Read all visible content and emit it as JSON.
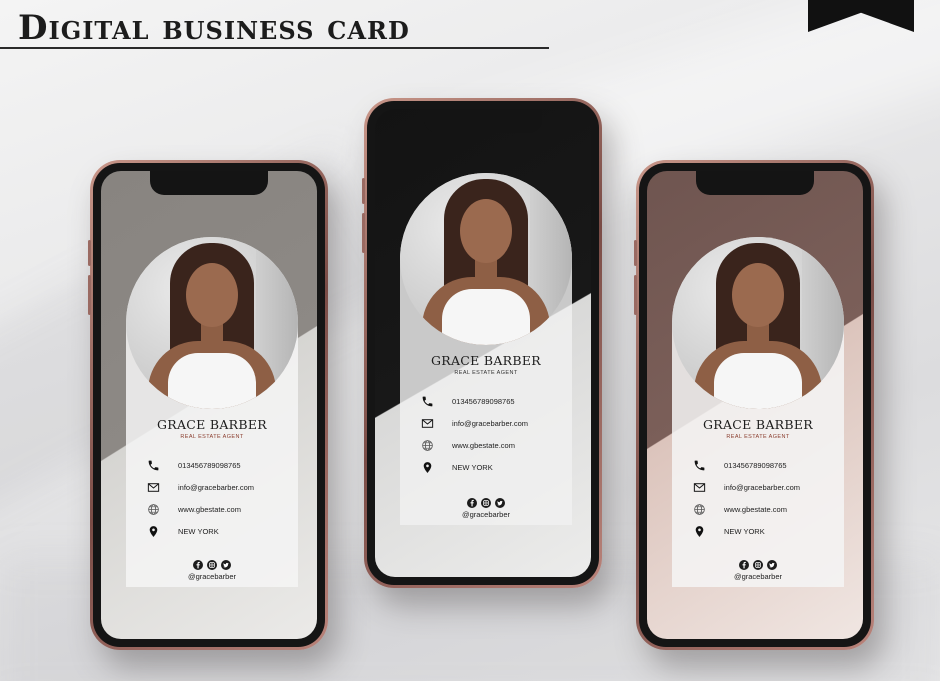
{
  "header": {
    "title": "Digital business card"
  },
  "cards": [
    {
      "name": "GRACE BARBER",
      "role": "REAL ESTATE AGENT",
      "contacts": [
        {
          "icon": "phone-icon",
          "text": "013456789098765"
        },
        {
          "icon": "email-icon",
          "text": "info@gracebarber.com"
        },
        {
          "icon": "globe-icon",
          "text": "www.gbestate.com"
        },
        {
          "icon": "location-pin-icon",
          "text": "NEW YORK"
        }
      ],
      "social_handle": "@gracebarber"
    },
    {
      "name": "GRACE BARBER",
      "role": "REAL ESTATE AGENT",
      "contacts": [
        {
          "icon": "phone-icon",
          "text": "013456789098765"
        },
        {
          "icon": "email-icon",
          "text": "info@gracebarber.com"
        },
        {
          "icon": "globe-icon",
          "text": "www.gbestate.com"
        },
        {
          "icon": "location-pin-icon",
          "text": "NEW YORK"
        }
      ],
      "social_handle": "@gracebarber"
    },
    {
      "name": "GRACE BARBER",
      "role": "REAL ESTATE AGENT",
      "contacts": [
        {
          "icon": "phone-icon",
          "text": "013456789098765"
        },
        {
          "icon": "email-icon",
          "text": "info@gracebarber.com"
        },
        {
          "icon": "globe-icon",
          "text": "www.gbestate.com"
        },
        {
          "icon": "location-pin-icon",
          "text": "NEW YORK"
        }
      ],
      "social_handle": "@gracebarber"
    }
  ],
  "social_icons": [
    "facebook-icon",
    "instagram-icon",
    "twitter-icon"
  ],
  "colors": {
    "phone_frame": "#8a5a52",
    "role_accent": "#8a3d2e",
    "card_1_bg": "#8d8985",
    "card_2_bg": "#181818",
    "card_3_bg": "#7b5f59"
  }
}
